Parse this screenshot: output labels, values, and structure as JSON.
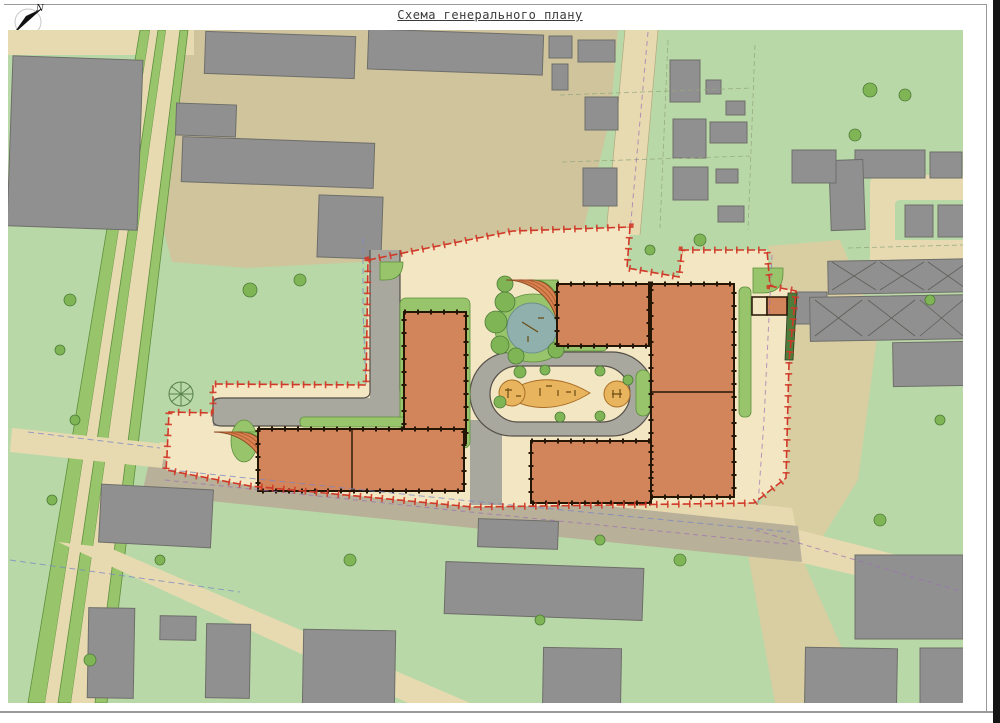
{
  "page": {
    "title": "Схема генерального плану",
    "north_label": "N"
  },
  "palette": {
    "page_bg": "#ffffff",
    "frame_line": "#9a9a9a",
    "edge_bar": "#141414",
    "title_color": "#3a3a3a",
    "base_green": "#b9d8a7",
    "lawn_green": "#98c56b",
    "bush_green": "#7fb554",
    "dark_hedge": "#4e7c3a",
    "tan_road": "#e7dab0",
    "olive_zone": "#cfc49c",
    "cream_paving": "#f3e6c2",
    "gray_building": "#909090",
    "gray_road": "#a9a89e",
    "orange_building": "#d2845a",
    "orange_play": "#e9b45e",
    "orange_ramp": "#d9824f",
    "teal_pond": "#8fb0ac",
    "red_boundary": "#d03928",
    "blue_utility": "#7b85c4",
    "purple_utility": "#9b6fb5"
  }
}
